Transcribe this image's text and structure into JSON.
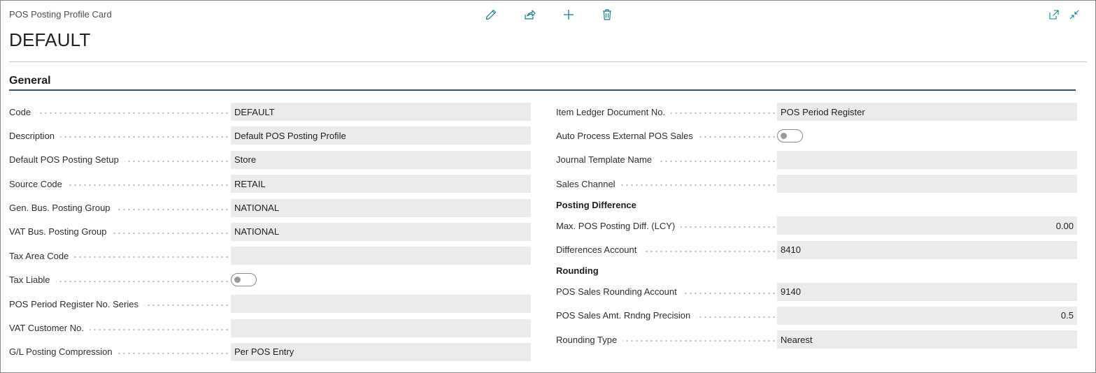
{
  "header": {
    "caption": "POS Posting Profile Card",
    "title": "DEFAULT"
  },
  "toolbar": {
    "icons": [
      "edit-icon",
      "share-icon",
      "new-icon",
      "delete-icon"
    ],
    "right_icons": [
      "open-new-window-icon",
      "collapse-icon"
    ],
    "accent_color": "#117c8c"
  },
  "general": {
    "title": "General",
    "left": [
      {
        "label": "Code",
        "value": "DEFAULT"
      },
      {
        "label": "Description",
        "value": "Default POS Posting Profile"
      },
      {
        "label": "Default POS Posting Setup",
        "value": "Store"
      },
      {
        "label": "Source Code",
        "value": "RETAIL"
      },
      {
        "label": "Gen. Bus. Posting Group",
        "value": "NATIONAL"
      },
      {
        "label": "VAT Bus. Posting Group",
        "value": "NATIONAL"
      },
      {
        "label": "Tax Area Code",
        "value": ""
      },
      {
        "label": "Tax Liable",
        "toggle": false
      },
      {
        "label": "POS Period Register No. Series",
        "value": ""
      },
      {
        "label": "VAT Customer No.",
        "value": ""
      },
      {
        "label": "G/L Posting Compression",
        "value": "Per POS Entry"
      }
    ],
    "right": [
      {
        "label": "Item Ledger Document No.",
        "value": "POS Period Register"
      },
      {
        "label": "Auto Process External POS Sales",
        "toggle": false
      },
      {
        "label": "Journal Template Name",
        "value": ""
      },
      {
        "label": "Sales Channel",
        "value": ""
      }
    ],
    "posting_difference": {
      "title": "Posting Difference",
      "fields": [
        {
          "label": "Max. POS Posting Diff. (LCY)",
          "value": "0.00"
        },
        {
          "label": "Differences Account",
          "value": "8410"
        }
      ]
    },
    "rounding": {
      "title": "Rounding",
      "fields": [
        {
          "label": "POS Sales Rounding Account",
          "value": "9140"
        },
        {
          "label": "POS Sales Amt. Rndng Precision",
          "value": "0.5"
        },
        {
          "label": "Rounding Type",
          "value": "Nearest"
        }
      ]
    }
  }
}
